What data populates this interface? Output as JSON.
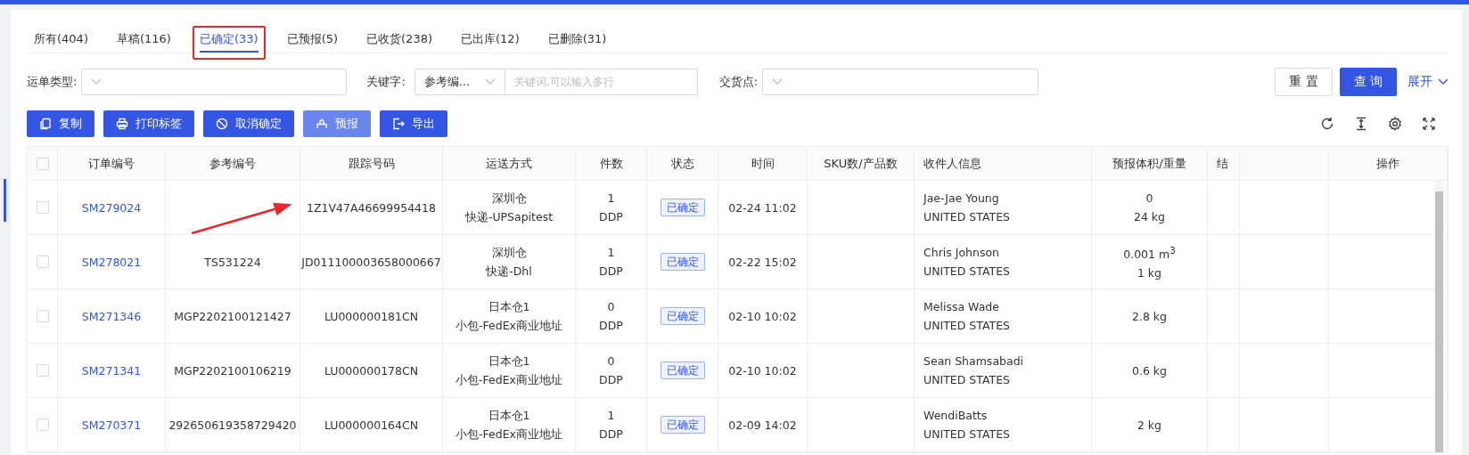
{
  "tabs": [
    {
      "label": "所有(404)",
      "selected": false,
      "highlighted": false
    },
    {
      "label": "草稿(116)",
      "selected": false,
      "highlighted": false
    },
    {
      "label": "已确定(33)",
      "selected": true,
      "highlighted": true
    },
    {
      "label": "已预报(5)",
      "selected": false,
      "highlighted": false
    },
    {
      "label": "已收货(238)",
      "selected": false,
      "highlighted": false
    },
    {
      "label": "已出库(12)",
      "selected": false,
      "highlighted": false
    },
    {
      "label": "已删除(31)",
      "selected": false,
      "highlighted": false
    }
  ],
  "filters": {
    "waybill_type": {
      "label": "运单类型:"
    },
    "keyword": {
      "label": "关键字:",
      "field_value": "参考编...",
      "placeholder": "关键词,可以输入多行"
    },
    "delivery_point": {
      "label": "交货点:"
    },
    "reset": "重 置",
    "query": "查 询",
    "expand": "展开"
  },
  "actions": [
    {
      "label": "复制",
      "kind": "copy",
      "disabled": false
    },
    {
      "label": "打印标签",
      "kind": "print",
      "disabled": false
    },
    {
      "label": "取消确定",
      "kind": "cancel",
      "disabled": false
    },
    {
      "label": "预报",
      "kind": "forecast",
      "disabled": true
    },
    {
      "label": "导出",
      "kind": "export",
      "disabled": false
    }
  ],
  "table": {
    "select_all_checked": false,
    "columns": [
      "订单编号",
      "参考编号",
      "跟踪号码",
      "运送方式",
      "件数",
      "状态",
      "时间",
      "SKU数/产品数",
      "收件人信息",
      "预报体积/重量",
      "结",
      "操作"
    ],
    "rows": [
      {
        "checked": false,
        "order": "SM279024",
        "reference": "",
        "tracking": "1Z1V47A46699954418",
        "warehouse": "深圳仓",
        "method": "快递-UPSapitest",
        "pieces": "1",
        "incoterm": "DDP",
        "status": "已确定",
        "time": "02-24 11:02",
        "recipient": "Jae-Jae Young",
        "country": "UNITED STATES",
        "volume_weight": [
          "0",
          "24 kg"
        ]
      },
      {
        "checked": false,
        "order": "SM278021",
        "reference": "TS531224",
        "tracking": "JD011100003658000667",
        "warehouse": "深圳仓",
        "method": "快递-Dhl",
        "pieces": "1",
        "incoterm": "DDP",
        "status": "已确定",
        "time": "02-22 15:02",
        "recipient": "Chris Johnson",
        "country": "UNITED STATES",
        "volume_weight": [
          "0.001 m$^{3}$",
          "1 kg"
        ]
      },
      {
        "checked": false,
        "order": "SM271346",
        "reference": "MGP2202100121427",
        "tracking": "LU000000181CN",
        "warehouse": "日本仓1",
        "method": "小包-FedEx商业地址",
        "pieces": "0",
        "incoterm": "DDP",
        "status": "已确定",
        "time": "02-10 10:02",
        "recipient": "Melissa Wade",
        "country": "UNITED STATES",
        "volume_weight": [
          "2.8 kg"
        ]
      },
      {
        "checked": false,
        "order": "SM271341",
        "reference": "MGP2202100106219",
        "tracking": "LU000000178CN",
        "warehouse": "日本仓1",
        "method": "小包-FedEx商业地址",
        "pieces": "0",
        "incoterm": "DDP",
        "status": "已确定",
        "time": "02-10 10:02",
        "recipient": "Sean Shamsabadi",
        "country": "UNITED STATES",
        "volume_weight": [
          "0.6 kg"
        ]
      },
      {
        "checked": false,
        "order": "SM270371",
        "reference": "292650619358729420",
        "tracking": "LU000000164CN",
        "warehouse": "日本仓1",
        "method": "小包-FedEx商业地址",
        "pieces": "1",
        "incoterm": "DDP",
        "status": "已确定",
        "time": "02-09 14:02",
        "recipient": "WendiBatts",
        "country": "UNITED STATES",
        "volume_weight": [
          "2 kg"
        ]
      }
    ]
  }
}
